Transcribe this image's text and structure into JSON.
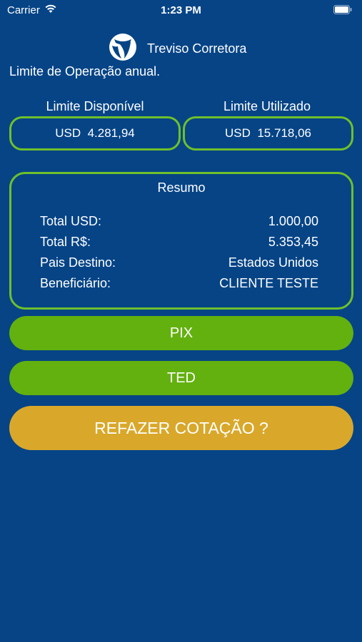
{
  "status_bar": {
    "carrier": "Carrier",
    "time": "1:23 PM",
    "wifi_icon": "wifi-icon",
    "battery_icon": "battery-icon"
  },
  "brand": {
    "name": "Treviso Corretora",
    "logo_icon": "globe-logo-icon"
  },
  "subtitle": "Limite de Operação anual.",
  "limits": {
    "available_label": "Limite Disponível",
    "available_value": "USD  4.281,94",
    "used_label": "Limite Utilizado",
    "used_value": "USD  15.718,06"
  },
  "resumo": {
    "title": "Resumo",
    "rows": [
      {
        "label": "Total USD:",
        "value": "1.000,00"
      },
      {
        "label": "Total R$:",
        "value": "5.353,45"
      },
      {
        "label": "Pais Destino:",
        "value": "Estados Unidos"
      },
      {
        "label": "Beneficiário:",
        "value": "CLIENTE TESTE"
      }
    ]
  },
  "buttons": {
    "pix": "PIX",
    "ted": "TED",
    "refazer": "REFAZER COTAÇÃO ?"
  },
  "colors": {
    "background": "#064486",
    "accent_green": "#63b10f",
    "border_green": "#6fc02b",
    "gold": "#d9a82b"
  }
}
